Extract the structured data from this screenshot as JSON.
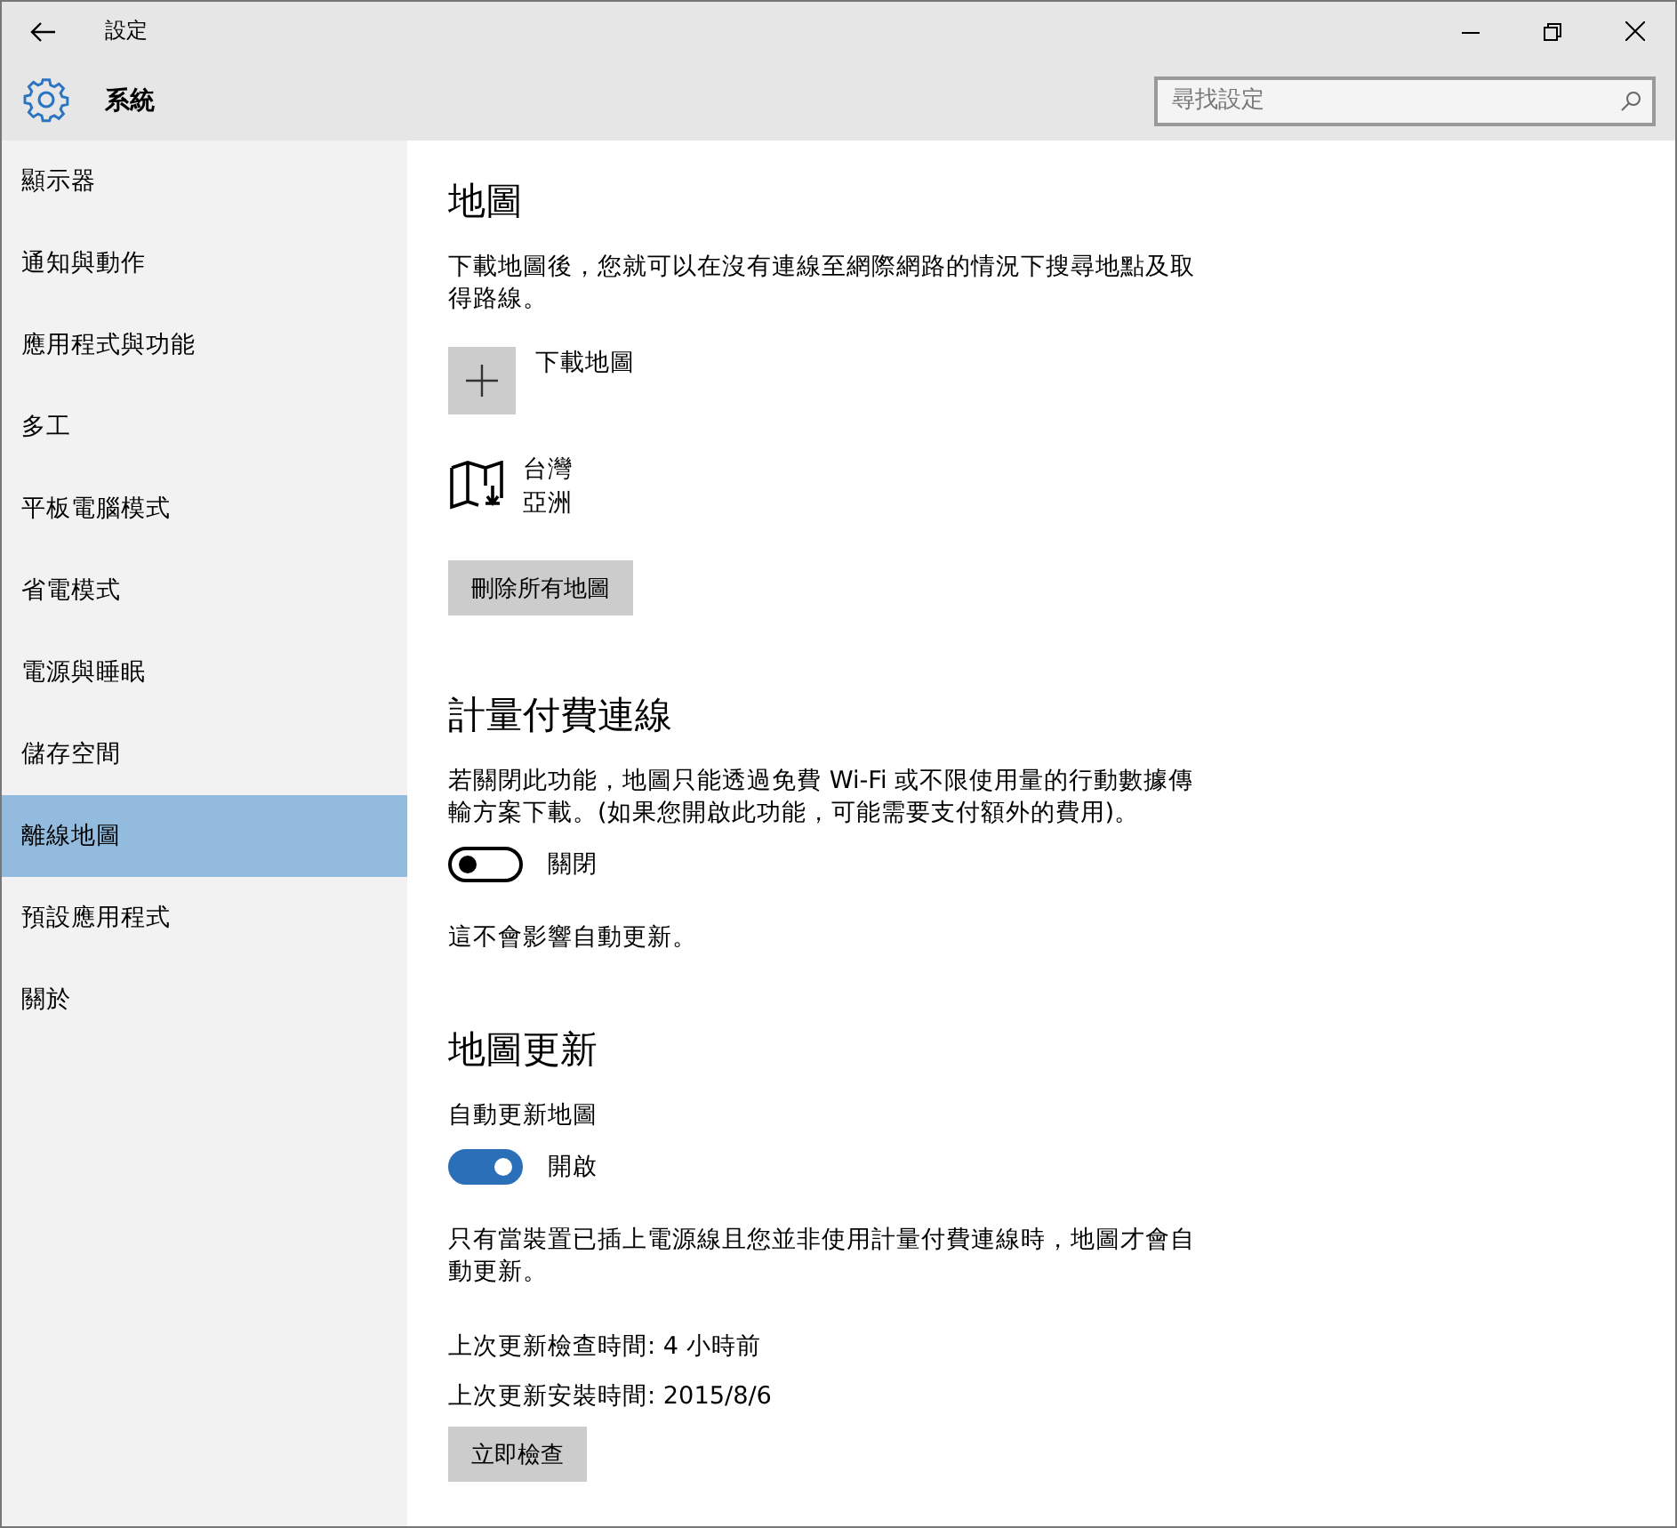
{
  "window": {
    "title": "設定"
  },
  "header": {
    "title": "系統",
    "search": {
      "placeholder": "尋找設定"
    }
  },
  "sidebar": {
    "items": [
      {
        "label": "顯示器",
        "selected": false
      },
      {
        "label": "通知與動作",
        "selected": false
      },
      {
        "label": "應用程式與功能",
        "selected": false
      },
      {
        "label": "多工",
        "selected": false
      },
      {
        "label": "平板電腦模式",
        "selected": false
      },
      {
        "label": "省電模式",
        "selected": false
      },
      {
        "label": "電源與睡眠",
        "selected": false
      },
      {
        "label": "儲存空間",
        "selected": false
      },
      {
        "label": "離線地圖",
        "selected": true
      },
      {
        "label": "預設應用程式",
        "selected": false
      },
      {
        "label": "關於",
        "selected": false
      }
    ]
  },
  "maps": {
    "heading": "地圖",
    "description": "下載地圖後，您就可以在沒有連線至網際網路的情況下搜尋地點及取得路線。",
    "add_label": "下載地圖",
    "downloaded": [
      {
        "name": "台灣",
        "region": "亞洲"
      }
    ],
    "delete_button": "刪除所有地圖"
  },
  "metered": {
    "heading": "計量付費連線",
    "description": "若關閉此功能，地圖只能透過免費 Wi-Fi 或不限使用量的行動數據傳輸方案下載。(如果您開啟此功能，可能需要支付額外的費用)。",
    "toggle": {
      "on": false,
      "state_label": "關閉"
    },
    "note": "這不會影響自動更新。"
  },
  "updates": {
    "heading": "地圖更新",
    "toggle_label": "自動更新地圖",
    "toggle": {
      "on": true,
      "state_label": "開啟"
    },
    "description": "只有當裝置已插上電源線且您並非使用計量付費連線時，地圖才會自動更新。",
    "last_checked": "上次更新檢查時間: 4 小時前",
    "last_installed": "上次更新安裝時間: 2015/8/6",
    "check_button": "立即檢查"
  }
}
